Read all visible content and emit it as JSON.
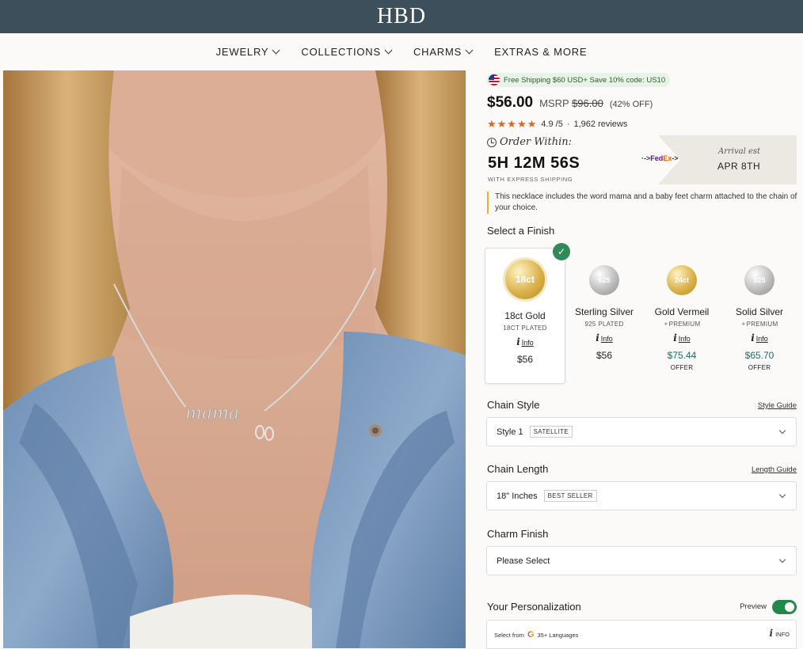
{
  "header": {
    "logo": "HBD"
  },
  "nav": [
    "JEWELRY",
    "COLLECTIONS",
    "CHARMS",
    "EXTRAS & MORE"
  ],
  "product_image": {
    "charm_text": "mama"
  },
  "shipping_pill": "Free Shipping $60 USD+ Save 10% code: US10",
  "price": {
    "current": "$56.00",
    "msrp_label": "MSRP",
    "msrp": "$96.00",
    "discount": "(42% OFF)"
  },
  "rating": {
    "stars": "★★★★★",
    "score": "4.9",
    "out_of": "/5",
    "separator": "·",
    "reviews": "1,962 reviews"
  },
  "order": {
    "within_label": "Order Within:",
    "countdown": "5H 12M 56S",
    "sub": "WITH EXPRESS SHIPPING",
    "carrier_prefix": "·->",
    "carrier_fe": "Fed",
    "carrier_ex": "Ex",
    "carrier_suffix": "->",
    "arrival_label": "Arrival est",
    "arrival_date": "APR 8TH"
  },
  "description": "This necklace includes the word mama and a baby feet charm attached to the chain of your choice.",
  "finish": {
    "title": "Select a Finish",
    "options": [
      {
        "coin": "18ct",
        "name": "18ct Gold",
        "sub": "18CT PLATED",
        "info": "Info",
        "price": "$56",
        "offer": ""
      },
      {
        "coin": "925",
        "name": "Sterling Silver",
        "sub": "925 PLATED",
        "info": "Info",
        "price": "$56",
        "offer": ""
      },
      {
        "coin": "24ct",
        "name": "Gold Vermeil",
        "sub": "PREMIUM",
        "info": "Info",
        "price": "$75.44",
        "offer": "OFFER"
      },
      {
        "coin": "925",
        "name": "Solid Silver",
        "sub": "PREMIUM",
        "info": "Info",
        "price": "$65.70",
        "offer": "OFFER"
      }
    ]
  },
  "chain_style": {
    "title": "Chain Style",
    "guide": "Style Guide",
    "value": "Style 1",
    "tag": "SATELLITE"
  },
  "chain_length": {
    "title": "Chain Length",
    "guide": "Length Guide",
    "value": "18\" Inches",
    "tag": "BEST SELLER"
  },
  "charm_finish": {
    "title": "Charm Finish",
    "value": "Please Select"
  },
  "personalization": {
    "title": "Your Personalization",
    "preview_label": "Preview",
    "preview_on": true,
    "lang_prefix": "Select from",
    "lang_suffix": "35+ Languages",
    "info_label": "INFO"
  },
  "colors": {
    "header_bg": "#3d4f5a",
    "star": "#e8641b",
    "accent_green": "#1f8a4a",
    "teal_price": "#1f6b6b"
  }
}
